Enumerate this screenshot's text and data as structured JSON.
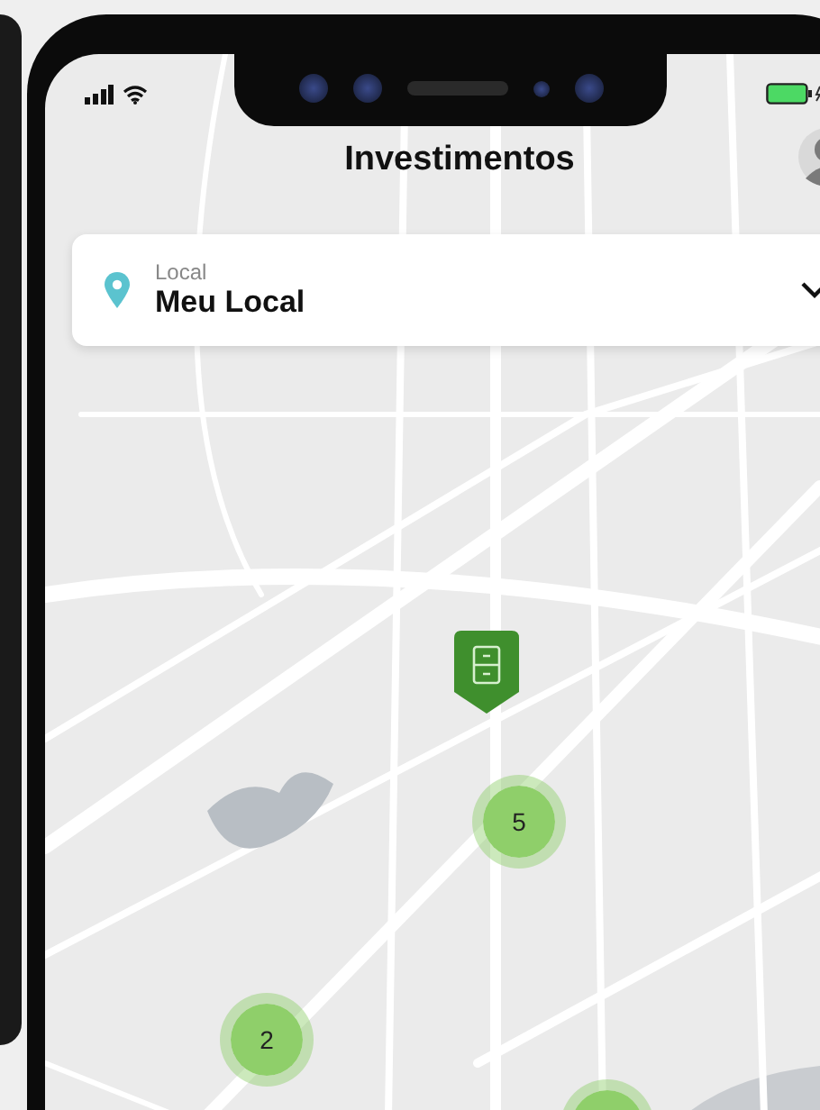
{
  "header": {
    "title": "Investimentos"
  },
  "location": {
    "label": "Local",
    "value": "Meu Local"
  },
  "markers": [
    {
      "kind": "pin"
    },
    {
      "kind": "cluster",
      "count": "5"
    },
    {
      "kind": "cluster",
      "count": "2"
    },
    {
      "kind": "cluster"
    }
  ]
}
